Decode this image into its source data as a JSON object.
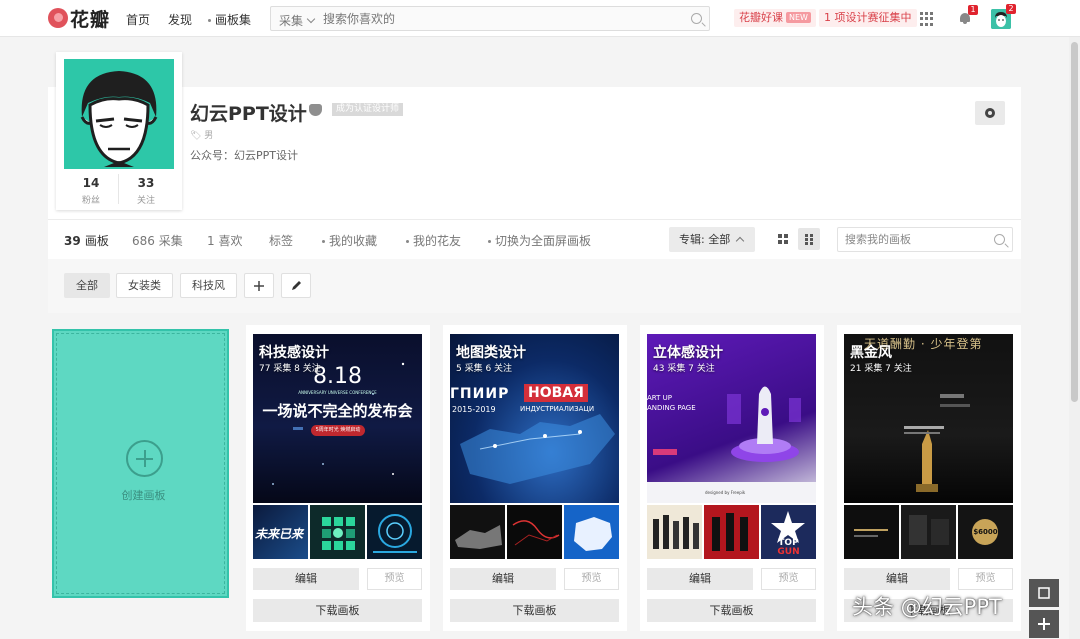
{
  "nav": {
    "logo": "花瓣",
    "links": [
      "首页",
      "发现",
      "画板集"
    ],
    "search_scope": "采集",
    "search_placeholder": "搜索你喜欢的",
    "promo": "花瓣好课",
    "promo_badge": "NEW",
    "contest": "1 项设计赛征集中",
    "notification_count": "1",
    "avatar_count": "2"
  },
  "profile": {
    "name": "幻云PPT设计",
    "verify_tag": "成为认证设计师",
    "gender": "男",
    "bio": "公众号：幻云PPT设计",
    "followers_count": "14",
    "followers_label": "粉丝",
    "following_count": "33",
    "following_label": "关注"
  },
  "tabs": {
    "boards": {
      "count": "39",
      "label": "画板"
    },
    "pins": {
      "count": "686",
      "label": "采集"
    },
    "likes": {
      "count": "1",
      "label": "喜欢"
    },
    "tags": "标签",
    "favorites": "我的收藏",
    "friends": "我的花友",
    "fullscreen": "切换为全面屏画板",
    "filter": "专辑: 全部",
    "board_search_placeholder": "搜索我的画板"
  },
  "categories": [
    "全部",
    "女装类",
    "科技风"
  ],
  "create_label": "创建画板",
  "boards": [
    {
      "title": "科技感设计",
      "meta": "77 采集  8 关注",
      "cover_text": [
        "8.18",
        "ANNIVERSARY UNIVERSE CONFERENCE",
        "一场说不完全的发布会",
        "5周年时光 焕燃启动"
      ],
      "thumb_texts": [
        "未来已来"
      ]
    },
    {
      "title": "地图类设计",
      "meta": "5 采集  6 关注",
      "cover_text": [
        "ГПИИР",
        "НОВАЯ",
        "ИНДУСТРИАЛИЗАЦИ",
        "2015-2019"
      ],
      "thumb_texts": []
    },
    {
      "title": "立体感设计",
      "meta": "43 采集  7 关注",
      "cover_text": [
        "ART UP",
        "ANDING PAGE",
        "designed by Freepik"
      ],
      "thumb_texts": [
        "TOP",
        "GUN"
      ]
    },
    {
      "title": "黑金风",
      "meta": "21 采集  7 关注",
      "cover_text": [
        "天道酬勤 · 少年登第"
      ],
      "thumb_texts": [
        "$6000"
      ]
    }
  ],
  "board_actions": {
    "edit": "编辑",
    "preview": "预览",
    "download": "下载画板"
  },
  "watermark": "头条 @幻云PPT"
}
